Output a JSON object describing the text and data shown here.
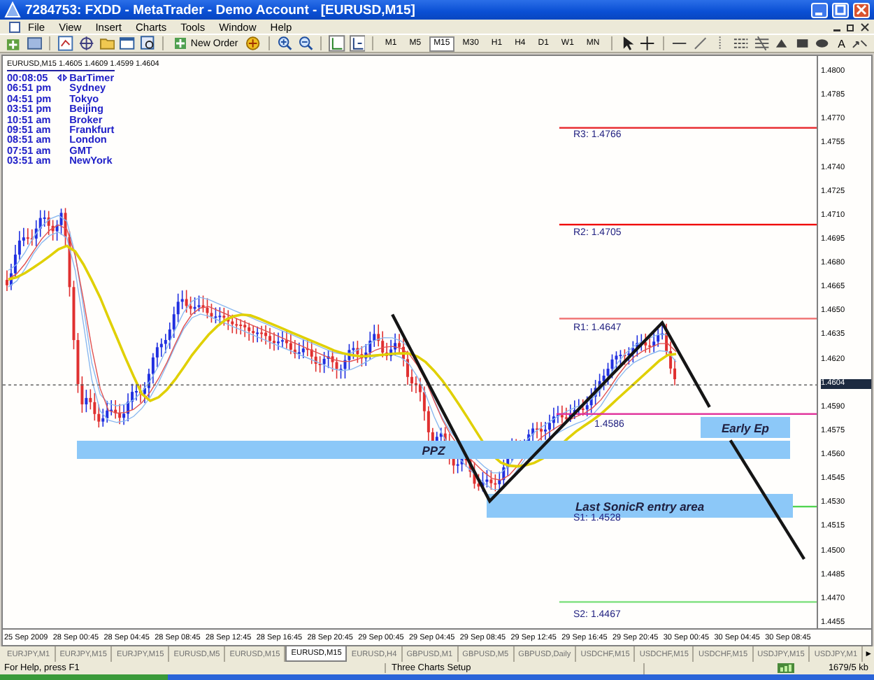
{
  "window": {
    "title": "7284753: FXDD - MetaTrader - Demo Account - [EURUSD,M15]"
  },
  "menu": [
    "File",
    "View",
    "Insert",
    "Charts",
    "Tools",
    "Window",
    "Help"
  ],
  "toolbar": {
    "new_order": "New Order",
    "text_tool": "A",
    "timeframes": [
      {
        "label": "M1",
        "selected": false
      },
      {
        "label": "M5",
        "selected": false
      },
      {
        "label": "M15",
        "selected": true
      },
      {
        "label": "M30",
        "selected": false
      },
      {
        "label": "H1",
        "selected": false
      },
      {
        "label": "H4",
        "selected": false
      },
      {
        "label": "D1",
        "selected": false
      },
      {
        "label": "W1",
        "selected": false
      },
      {
        "label": "MN",
        "selected": false
      }
    ]
  },
  "chart": {
    "header": "EURUSD,M15  1.4605 1.4609 1.4599 1.4604",
    "clock": [
      {
        "time": "00:08:05",
        "place": "BarTimer",
        "kind": "timer"
      },
      {
        "time": "06:51 pm",
        "place": "Sydney",
        "kind": "city"
      },
      {
        "time": "04:51 pm",
        "place": "Tokyo",
        "kind": "city"
      },
      {
        "time": "03:51 pm",
        "place": "Beijing",
        "kind": "city"
      },
      {
        "time": "10:51 am",
        "place": "Broker",
        "kind": "city"
      },
      {
        "time": "09:51 am",
        "place": "Frankfurt",
        "kind": "city"
      },
      {
        "time": "08:51 am",
        "place": "London",
        "kind": "city"
      },
      {
        "time": "07:51 am",
        "place": "GMT",
        "kind": "city"
      },
      {
        "time": "03:51 am",
        "place": "NewYork",
        "kind": "city"
      }
    ],
    "levels": [
      {
        "label": "R3: 1.4766",
        "color": "#e8282c"
      },
      {
        "label": "R2: 1.4705",
        "color": "#f00000"
      },
      {
        "label": "R1: 1.4647",
        "color": "#f07070"
      },
      {
        "label": "1.4586",
        "color": "#e0309a"
      },
      {
        "label": "S1: 1.4528",
        "color": "#52d452"
      },
      {
        "label": "S2: 1.4467",
        "color": "#7ee07e"
      }
    ],
    "zones": [
      {
        "label": "Early Ep"
      },
      {
        "label": "PPZ"
      },
      {
        "label": "Last SonicR entry area"
      }
    ],
    "price_axis": [
      {
        "label": "1.4800",
        "current": false
      },
      {
        "label": "1.4785",
        "current": false
      },
      {
        "label": "1.4770",
        "current": false
      },
      {
        "label": "1.4755",
        "current": false
      },
      {
        "label": "1.4740",
        "current": false
      },
      {
        "label": "1.4725",
        "current": false
      },
      {
        "label": "1.4710",
        "current": false
      },
      {
        "label": "1.4695",
        "current": false
      },
      {
        "label": "1.4680",
        "current": false
      },
      {
        "label": "1.4665",
        "current": false
      },
      {
        "label": "1.4650",
        "current": false
      },
      {
        "label": "1.4635",
        "current": false
      },
      {
        "label": "1.4620",
        "current": false
      },
      {
        "label": "1.4604",
        "current": true
      },
      {
        "label": "1.4590",
        "current": false
      },
      {
        "label": "1.4575",
        "current": false
      },
      {
        "label": "1.4560",
        "current": false
      },
      {
        "label": "1.4545",
        "current": false
      },
      {
        "label": "1.4530",
        "current": false
      },
      {
        "label": "1.4515",
        "current": false
      },
      {
        "label": "1.4500",
        "current": false
      },
      {
        "label": "1.4485",
        "current": false
      },
      {
        "label": "1.4470",
        "current": false
      },
      {
        "label": "1.4455",
        "current": false
      }
    ],
    "time_axis": [
      "25 Sep 2009",
      "28 Sep 00:45",
      "28 Sep 04:45",
      "28 Sep 08:45",
      "28 Sep 12:45",
      "28 Sep 16:45",
      "28 Sep 20:45",
      "29 Sep 00:45",
      "29 Sep 04:45",
      "29 Sep 08:45",
      "29 Sep 12:45",
      "29 Sep 16:45",
      "29 Sep 20:45",
      "30 Sep 00:45",
      "30 Sep 04:45",
      "30 Sep 08:45"
    ]
  },
  "tabs": [
    {
      "label": "EURJPY,M1",
      "selected": false
    },
    {
      "label": "EURJPY,M15",
      "selected": false
    },
    {
      "label": "EURJPY,M15",
      "selected": false
    },
    {
      "label": "EURUSD,M5",
      "selected": false
    },
    {
      "label": "EURUSD,M15",
      "selected": false
    },
    {
      "label": "EURUSD,M15",
      "selected": true
    },
    {
      "label": "EURUSD,H4",
      "selected": false
    },
    {
      "label": "GBPUSD,M1",
      "selected": false
    },
    {
      "label": "GBPUSD,M5",
      "selected": false
    },
    {
      "label": "GBPUSD,Daily",
      "selected": false
    },
    {
      "label": "USDCHF,M15",
      "selected": false
    },
    {
      "label": "USDCHF,M15",
      "selected": false
    },
    {
      "label": "USDCHF,M15",
      "selected": false
    },
    {
      "label": "USDJPY,M15",
      "selected": false
    },
    {
      "label": "USDJPY,M1",
      "selected": false
    }
  ],
  "tab_scroll": "►",
  "status_bar": {
    "help": "For Help, press F1",
    "profile": "Three Charts Setup",
    "traffic": "1679/5 kb"
  }
}
